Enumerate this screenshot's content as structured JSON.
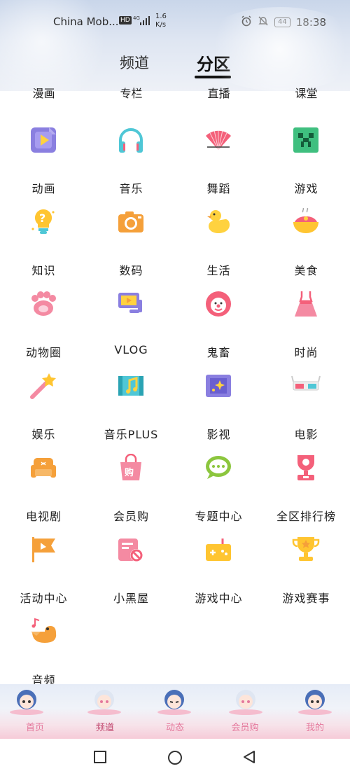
{
  "status_bar": {
    "carrier": "China Mob...",
    "hd": "HD",
    "network": "4G",
    "speed_value": "1.6",
    "speed_unit": "K/s",
    "battery": "44",
    "time": "18:38"
  },
  "tabs": [
    {
      "label": "频道",
      "selected": false
    },
    {
      "label": "分区",
      "selected": true
    }
  ],
  "partial_row": [
    "漫画",
    "专栏",
    "直播",
    "课堂"
  ],
  "categories": [
    {
      "label": "动画",
      "icon": "animation-icon"
    },
    {
      "label": "音乐",
      "icon": "headphones-icon"
    },
    {
      "label": "舞蹈",
      "icon": "fan-icon"
    },
    {
      "label": "游戏",
      "icon": "creeper-icon"
    },
    {
      "label": "知识",
      "icon": "lightbulb-icon"
    },
    {
      "label": "数码",
      "icon": "camera-icon"
    },
    {
      "label": "生活",
      "icon": "duck-icon"
    },
    {
      "label": "美食",
      "icon": "food-bowl-icon"
    },
    {
      "label": "动物圈",
      "icon": "paw-icon"
    },
    {
      "label": "VLOG",
      "icon": "vlog-camera-icon"
    },
    {
      "label": "鬼畜",
      "icon": "clown-icon"
    },
    {
      "label": "时尚",
      "icon": "dress-icon"
    },
    {
      "label": "娱乐",
      "icon": "magic-wand-icon"
    },
    {
      "label": "音乐PLUS",
      "icon": "film-music-icon"
    },
    {
      "label": "影视",
      "icon": "film-sparkle-icon"
    },
    {
      "label": "电影",
      "icon": "3d-glasses-icon"
    },
    {
      "label": "电视剧",
      "icon": "sofa-icon"
    },
    {
      "label": "会员购",
      "icon": "shopping-bag-icon"
    },
    {
      "label": "专题中心",
      "icon": "speech-bubble-icon"
    },
    {
      "label": "全区排行榜",
      "icon": "trophy-icon"
    },
    {
      "label": "活动中心",
      "icon": "flag-icon"
    },
    {
      "label": "小黑屋",
      "icon": "ban-icon"
    },
    {
      "label": "游戏中心",
      "icon": "gamepad-icon"
    },
    {
      "label": "游戏赛事",
      "icon": "cup-star-icon"
    },
    {
      "label": "音频",
      "icon": "bird-music-icon"
    }
  ],
  "bottom_nav": [
    {
      "label": "首页"
    },
    {
      "label": "频道"
    },
    {
      "label": "动态"
    },
    {
      "label": "会员购"
    },
    {
      "label": "我的"
    }
  ],
  "colors": {
    "accent_pink": "#e4789c",
    "orange": "#f5a03a",
    "purple": "#8a7fe0",
    "teal": "#4fc7d6",
    "red": "#f4607a",
    "green": "#3fbf7f"
  }
}
